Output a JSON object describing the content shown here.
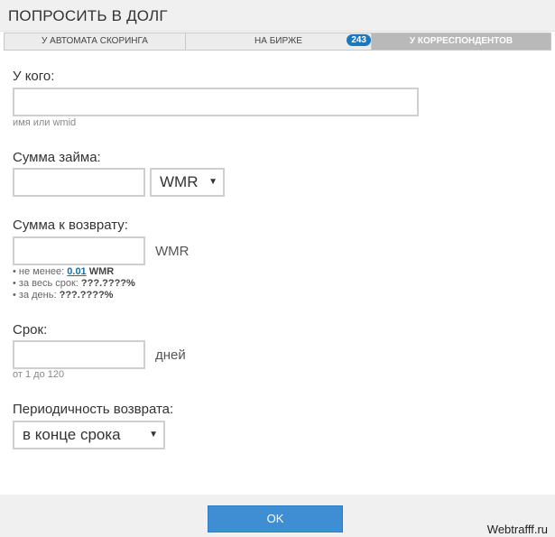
{
  "dialog": {
    "title": "ПОПРОСИТЬ В ДОЛГ"
  },
  "tabs": [
    {
      "label": "У АВТОМАТА СКОРИНГА"
    },
    {
      "label": "НА БИРЖЕ",
      "badge": "243"
    },
    {
      "label": "У КОРРЕСПОНДЕНТОВ",
      "active": true
    }
  ],
  "form": {
    "recipient": {
      "label": "У кого:",
      "value": "",
      "hint": "имя или wmid"
    },
    "amount": {
      "label": "Сумма займа:",
      "value": "",
      "currency_selected": "WMR"
    },
    "return_amount": {
      "label": "Сумма к возврату:",
      "value": "",
      "unit": "WMR",
      "min_prefix": "• не менее: ",
      "min_value": "0.01",
      "min_unit": " WMR",
      "total_prefix": "• за весь срок: ",
      "total_value": "???.????%",
      "daily_prefix": "• за день: ",
      "daily_value": "???.????%"
    },
    "term": {
      "label": "Срок:",
      "value": "",
      "unit": "дней",
      "hint": "от 1 до 120"
    },
    "periodicity": {
      "label": "Периодичность возврата:",
      "selected": "в конце срока"
    }
  },
  "footer": {
    "ok_label": "OK",
    "watermark": "Webtrafff.ru"
  },
  "colors": {
    "accent": "#3f8ed3",
    "badge": "#1c78be",
    "active_tab": "#b9b9b9"
  }
}
